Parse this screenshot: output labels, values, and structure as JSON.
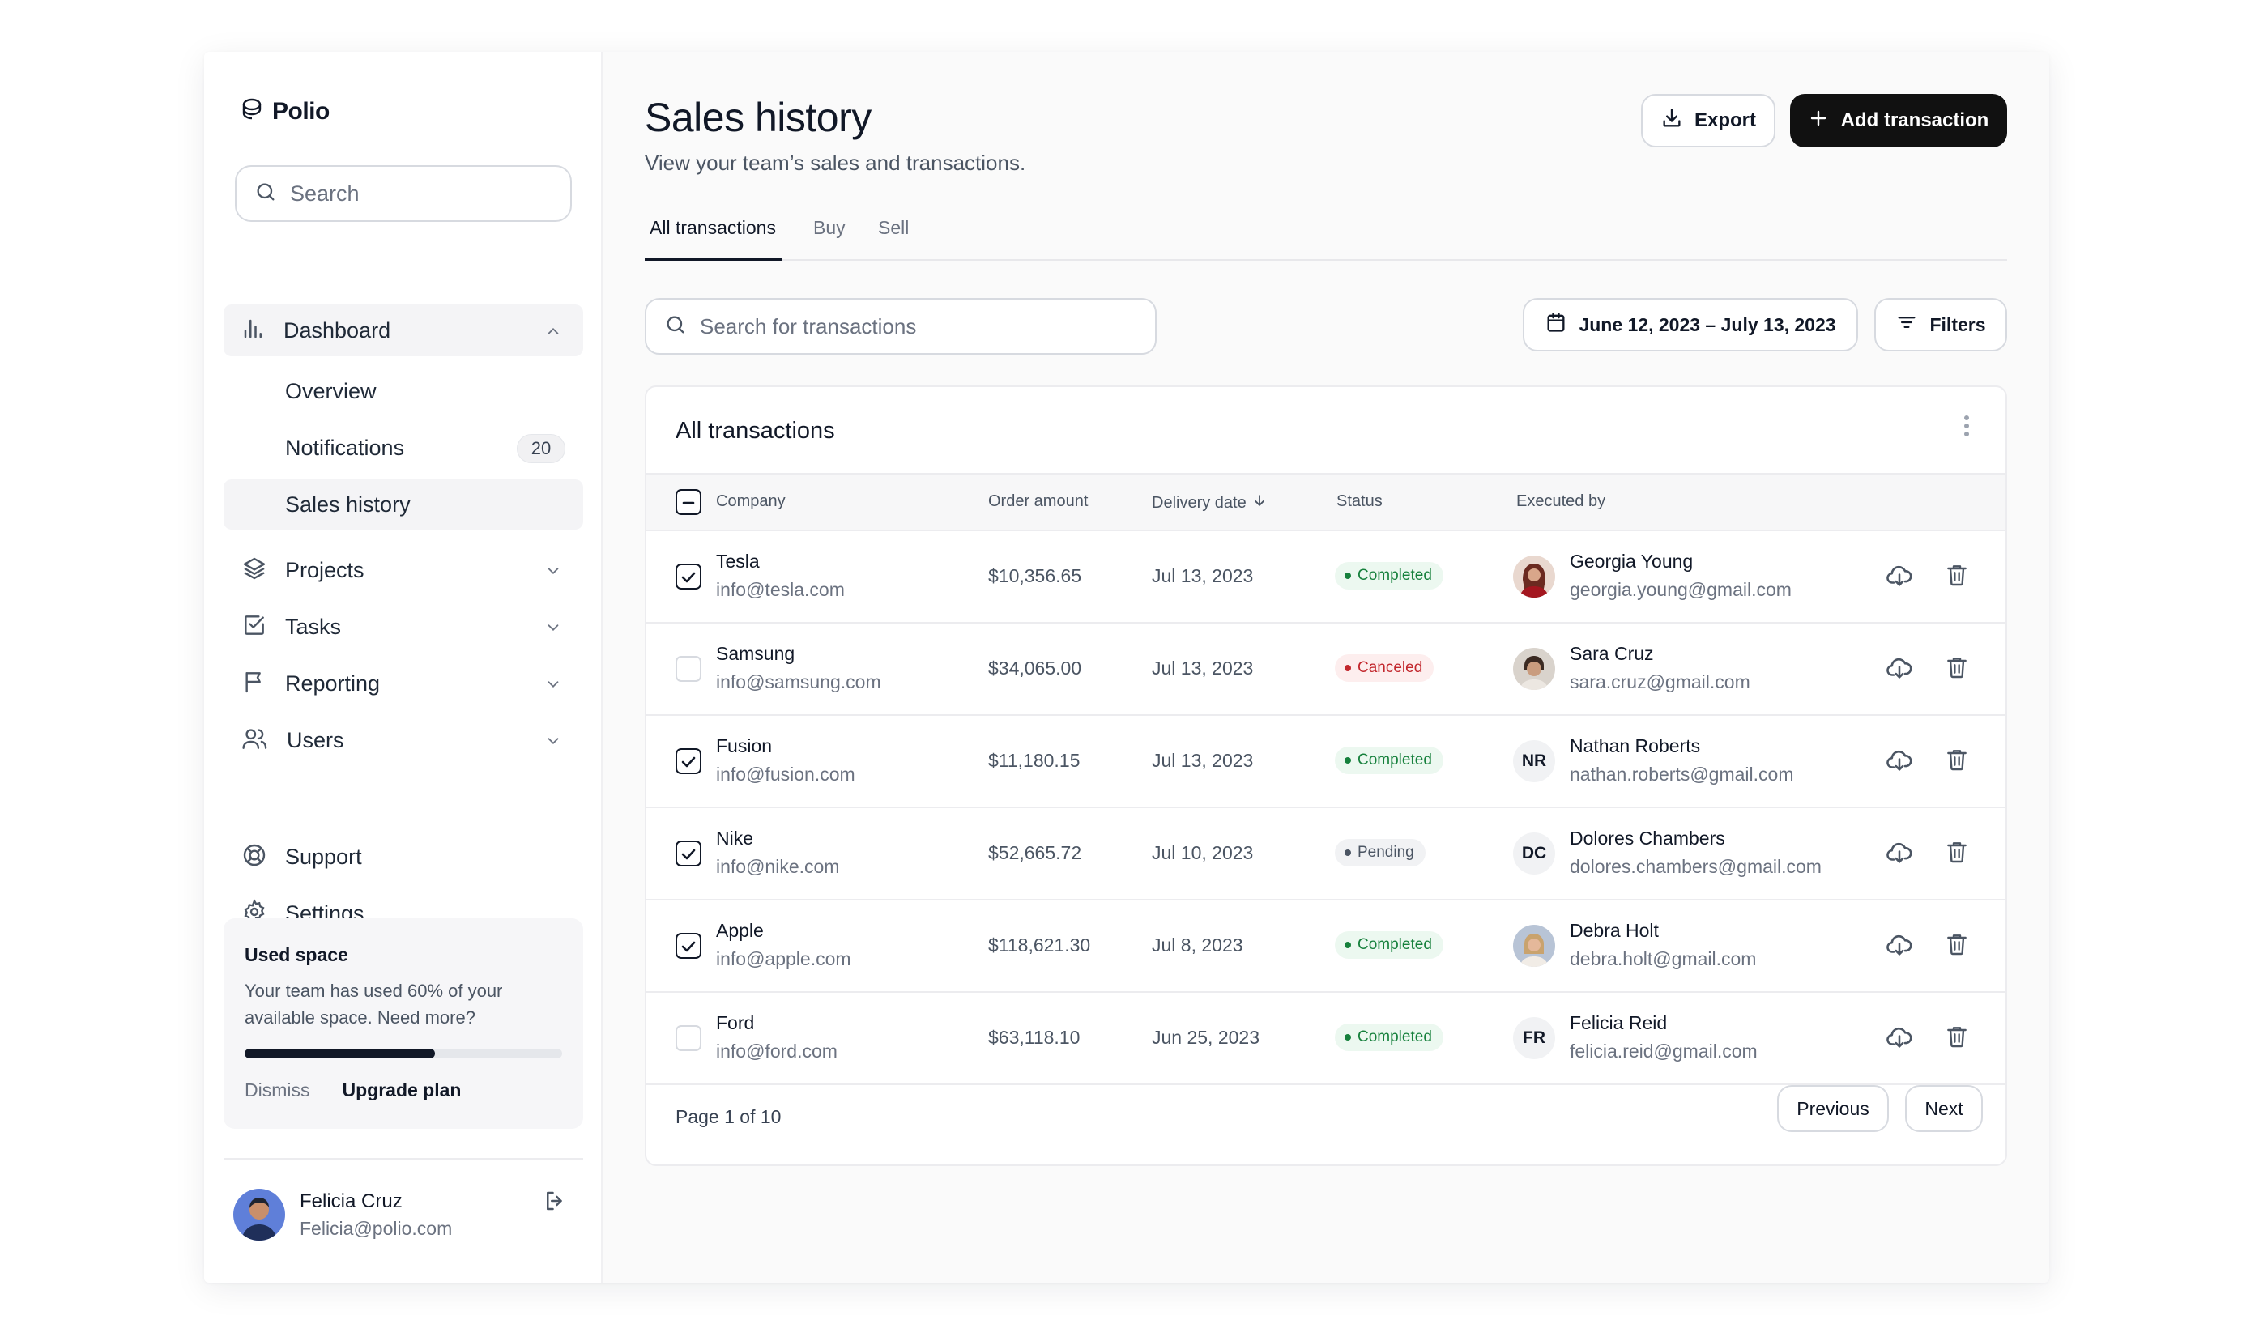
{
  "app": {
    "name": "Polio"
  },
  "sidebar": {
    "search_placeholder": "Search",
    "dashboard": {
      "label": "Dashboard",
      "sub": [
        {
          "label": "Overview"
        },
        {
          "label": "Notifications",
          "badge": "20"
        },
        {
          "label": "Sales history"
        }
      ]
    },
    "nav": [
      {
        "label": "Projects"
      },
      {
        "label": "Tasks"
      },
      {
        "label": "Reporting"
      },
      {
        "label": "Users"
      }
    ],
    "support": "Support",
    "settings": "Settings",
    "space": {
      "title": "Used space",
      "description": "Your team has used 60% of your available space. Need more?",
      "used_fraction": 0.6,
      "dismiss": "Dismiss",
      "upgrade": "Upgrade plan"
    },
    "user": {
      "name": "Felicia Cruz",
      "email": "Felicia@polio.com"
    }
  },
  "header": {
    "title": "Sales history",
    "subtitle": "View your team’s sales and transactions.",
    "export_label": "Export",
    "add_label": "Add transaction"
  },
  "tabs": [
    {
      "label": "All transactions",
      "active": true
    },
    {
      "label": "Buy"
    },
    {
      "label": "Sell"
    }
  ],
  "toolbar": {
    "search_placeholder": "Search for transactions",
    "date_range": "June 12, 2023 – July 13, 2023",
    "filters_label": "Filters"
  },
  "table": {
    "title": "All transactions",
    "columns": {
      "company": "Company",
      "amount": "Order amount",
      "date": "Delivery date",
      "status": "Status",
      "executed": "Executed by"
    },
    "rows": [
      {
        "company": "Tesla",
        "company_email": "info@tesla.com",
        "amount": "$10,356.65",
        "date": "Jul 13, 2023",
        "status": "Completed",
        "status_key": "completed",
        "checked": true,
        "exec_name": "Georgia Young",
        "exec_email": "georgia.young@gmail.com",
        "exec_initials": ""
      },
      {
        "company": "Samsung",
        "company_email": "info@samsung.com",
        "amount": "$34,065.00",
        "date": "Jul 13, 2023",
        "status": "Canceled",
        "status_key": "canceled",
        "checked": false,
        "exec_name": "Sara Cruz",
        "exec_email": "sara.cruz@gmail.com",
        "exec_initials": ""
      },
      {
        "company": "Fusion",
        "company_email": "info@fusion.com",
        "amount": "$11,180.15",
        "date": "Jul 13, 2023",
        "status": "Completed",
        "status_key": "completed",
        "checked": true,
        "exec_name": "Nathan Roberts",
        "exec_email": "nathan.roberts@gmail.com",
        "exec_initials": "NR"
      },
      {
        "company": "Nike",
        "company_email": "info@nike.com",
        "amount": "$52,665.72",
        "date": "Jul 10, 2023",
        "status": "Pending",
        "status_key": "pending",
        "checked": true,
        "exec_name": "Dolores Chambers",
        "exec_email": "dolores.chambers@gmail.com",
        "exec_initials": "DC"
      },
      {
        "company": "Apple",
        "company_email": "info@apple.com",
        "amount": "$118,621.30",
        "date": "Jul 8, 2023",
        "status": "Completed",
        "status_key": "completed",
        "checked": true,
        "exec_name": "Debra Holt",
        "exec_email": "debra.holt@gmail.com",
        "exec_initials": ""
      },
      {
        "company": "Ford",
        "company_email": "info@ford.com",
        "amount": "$63,118.10",
        "date": "Jun 25, 2023",
        "status": "Completed",
        "status_key": "completed",
        "checked": false,
        "exec_name": "Felicia Reid",
        "exec_email": "felicia.reid@gmail.com",
        "exec_initials": "FR"
      }
    ],
    "page_text": "Page 1 of 10",
    "prev_label": "Previous",
    "next_label": "Next"
  },
  "colors": {
    "primary": "#111111",
    "completed": "#16803c",
    "canceled": "#c2272d",
    "pending": "#4b5563"
  },
  "icons": [
    "polio-logo-icon",
    "search-icon",
    "bar-chart-icon",
    "chevron-up-icon",
    "chevron-down-icon",
    "layers-icon",
    "check-square-icon",
    "flag-icon",
    "users-icon",
    "life-buoy-icon",
    "gear-icon",
    "logout-icon",
    "download-icon",
    "plus-icon",
    "calendar-icon",
    "filter-lines-icon",
    "more-vertical-icon",
    "arrow-down-icon",
    "cloud-download-icon",
    "trash-icon"
  ]
}
